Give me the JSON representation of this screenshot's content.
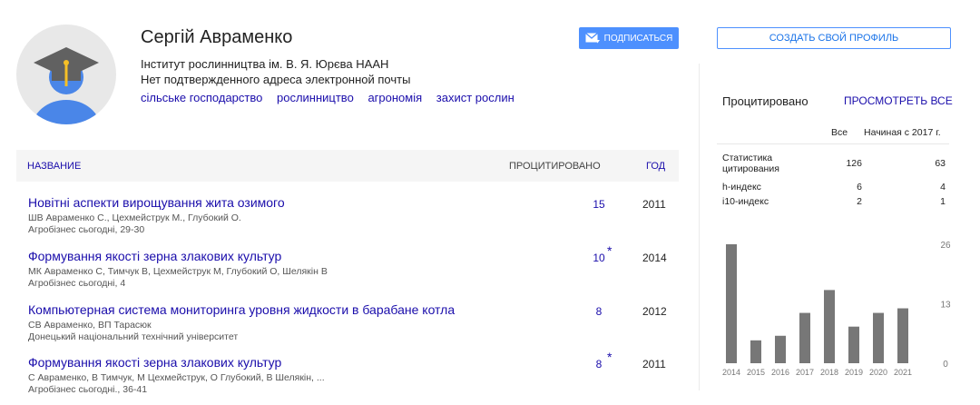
{
  "profile": {
    "name": "Сергій Авраменко",
    "affiliation": "Інститут рослинництва ім. В. Я. Юрєва НААН",
    "email_status": "Нет подтвержденного адреса электронной почты",
    "interests": [
      "сільське господарство",
      "рослинництво",
      "агрономія",
      "захист рослин"
    ],
    "follow_label": "ПОДПИСАТЬСЯ"
  },
  "table": {
    "headers": {
      "title": "НАЗВАНИЕ",
      "cited": "ПРОЦИТИРОВАНО",
      "year": "ГОД"
    },
    "rows": [
      {
        "title": "Новітні аспекти вирощування жита озимого",
        "authors": "ШВ Авраменко С., Цехмейструк М., Глубокий О.",
        "source": "Агробізнес сьогодні, 29-30",
        "cited": "15",
        "star": "",
        "year": "2011"
      },
      {
        "title": "Формування якості зерна злакових культур",
        "authors": "МК Авраменко С, Тимчук В, Цехмейструк М, Глубокий О, Шелякін В",
        "source": "Агробізнес сьогодні, 4",
        "cited": "10",
        "star": "*",
        "year": "2014"
      },
      {
        "title": "Компьютерная система мониторинга уровня жидкости в барабане котла",
        "authors": "СВ Авраменко, ВП Тарасюк",
        "source": "Донецький національний технічний університет",
        "cited": "8",
        "star": "",
        "year": "2012"
      },
      {
        "title": "Формування якості зерна злакових культур",
        "authors": "С Авраменко, В Тимчук, М Цехмейструк, О Глубокий, В Шелякін, ...",
        "source": "Агробізнес сьогодні., 36-41",
        "cited": "8",
        "star": "*",
        "year": "2011"
      }
    ]
  },
  "sidebar": {
    "create_profile_label": "СОЗДАТЬ СВОЙ ПРОФИЛЬ",
    "cited_title": "Процитировано",
    "view_all_label": "ПРОСМОТРЕТЬ ВСЕ",
    "col_all": "Все",
    "col_since": "Начиная с 2017 г.",
    "stats": [
      {
        "label": "Статистика цитирования",
        "all": "126",
        "since": "63"
      },
      {
        "label": "h-индекс",
        "all": "6",
        "since": "4"
      },
      {
        "label": "i10-индекс",
        "all": "2",
        "since": "1"
      }
    ]
  },
  "chart_data": {
    "type": "bar",
    "categories": [
      "2014",
      "2015",
      "2016",
      "2017",
      "2018",
      "2019",
      "2020",
      "2021"
    ],
    "values": [
      26,
      5,
      6,
      11,
      16,
      8,
      11,
      12
    ],
    "ylim": [
      0,
      26
    ],
    "yticks": [
      "26",
      "13",
      "0"
    ],
    "bar_color": "#777777"
  }
}
